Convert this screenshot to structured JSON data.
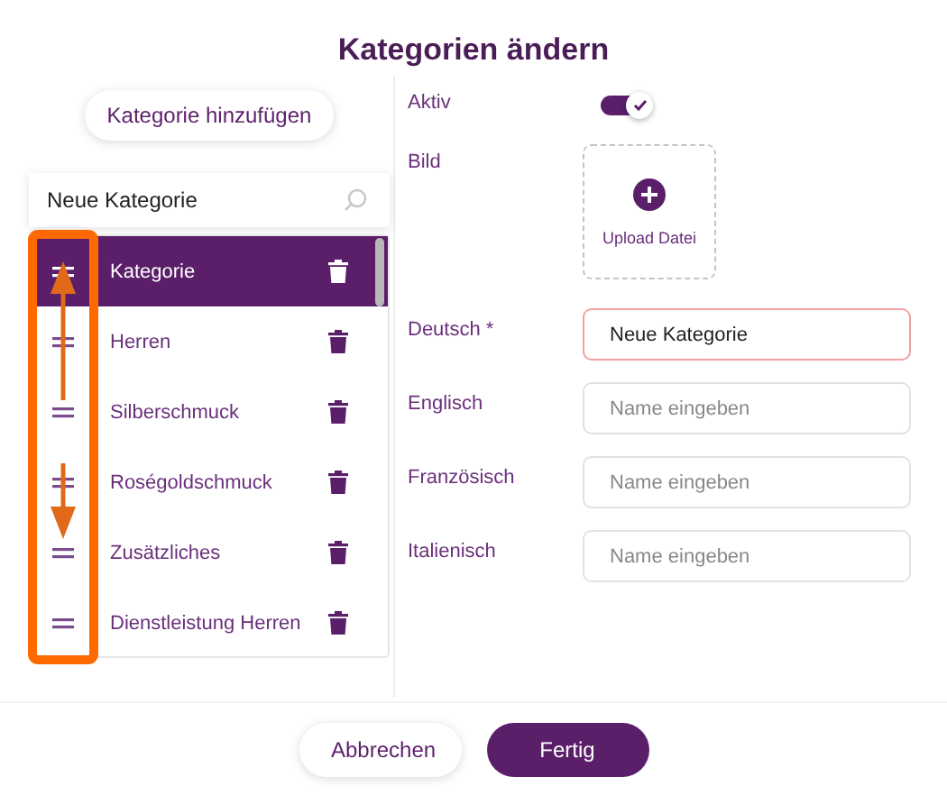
{
  "title": "Kategorien ändern",
  "add_button": "Kategorie hinzufügen",
  "search": {
    "value": "Neue Kategorie"
  },
  "categories": [
    {
      "label": "Kategorie",
      "selected": true
    },
    {
      "label": "Herren",
      "selected": false
    },
    {
      "label": "Silberschmuck",
      "selected": false
    },
    {
      "label": "Roségoldschmuck",
      "selected": false
    },
    {
      "label": "Zusätzliches",
      "selected": false
    },
    {
      "label": "Dienstleistung Herren",
      "selected": false
    }
  ],
  "active": {
    "label": "Aktiv",
    "on": true
  },
  "image": {
    "label": "Bild",
    "upload_label": "Upload Datei"
  },
  "languages": [
    {
      "label": "Deutsch *",
      "value": "Neue Kategorie",
      "error": true
    },
    {
      "label": "Englisch",
      "placeholder": "Name eingeben",
      "error": false
    },
    {
      "label": "Französisch",
      "placeholder": "Name eingeben",
      "error": false
    },
    {
      "label": "Italienisch",
      "placeholder": "Name eingeben",
      "error": false
    }
  ],
  "buttons": [
    {
      "label": "Abbrechen",
      "kind": "secondary"
    },
    {
      "label": "Fertig",
      "kind": "primary"
    }
  ]
}
